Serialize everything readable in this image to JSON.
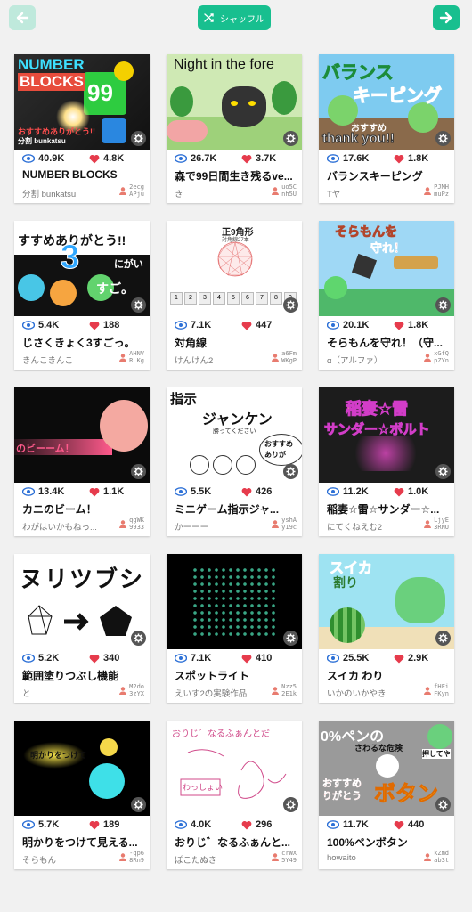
{
  "header": {
    "shuffle_label": "シャッフル"
  },
  "colors": {
    "accent": "#18bf8f",
    "accent_disabled": "#bfe9dc",
    "heart": "#e63b4c",
    "eye": "#2b6fd6"
  },
  "games": [
    {
      "views": "40.9K",
      "likes": "4.8K",
      "title": "NUMBER BLOCKS",
      "author": "分割 bunkatsu",
      "uid": "2ecg\nAPju",
      "thumb_texts": [
        "NUMBER",
        "BLOCKS",
        "99",
        "おすすめありがとう!!",
        "分割 bunkatsu"
      ]
    },
    {
      "views": "26.7K",
      "likes": "3.7K",
      "title": "森で99日間生き残るve...",
      "author": "き",
      "uid": "uo5C\nnh5U",
      "thumb_texts": [
        "Night in the fore"
      ]
    },
    {
      "views": "17.6K",
      "likes": "1.8K",
      "title": "バランスキーピング",
      "author": "Tヤ",
      "uid": "PJMH\nmuPz",
      "thumb_texts": [
        "バランス",
        "キーピング",
        "おすすめ",
        "thank you!!"
      ]
    },
    {
      "views": "5.4K",
      "likes": "188",
      "title": "じさくきょく3すごっ。",
      "author": "きんこきんこ",
      "uid": "AHNV\nRLKg",
      "thumb_texts": [
        "すすめありがとう!!",
        "3",
        "すご。",
        "にがい"
      ]
    },
    {
      "views": "7.1K",
      "likes": "447",
      "title": "対角線",
      "author": "けんけん2",
      "uid": "a6Fm\nWKgP",
      "thumb_texts": [
        "正9角形",
        "対角線27本",
        "1",
        "2",
        "3",
        "4",
        "5",
        "6",
        "7",
        "8",
        "9"
      ]
    },
    {
      "views": "20.1K",
      "likes": "1.8K",
      "title": "そらもんを守れ！（守...",
      "author": "α（アルファ）",
      "uid": "xGfQ\npZYn",
      "thumb_texts": [
        "そらもんを",
        "守れ！"
      ]
    },
    {
      "views": "13.4K",
      "likes": "1.1K",
      "title": "カニのビーム！",
      "author": "わがはいかもねっ...",
      "uid": "qgWK\n9933",
      "thumb_texts": [
        "のビーーム！"
      ]
    },
    {
      "views": "5.5K",
      "likes": "426",
      "title": "ミニゲーム指示ジャ...",
      "author": "かーーー",
      "uid": "yshA\ny19c",
      "thumb_texts": [
        "指示",
        "ジャンケン",
        "勝ってください",
        "おすすめ",
        "ありが"
      ]
    },
    {
      "views": "11.2K",
      "likes": "1.0K",
      "title": "稲妻☆雷☆サンダー☆...",
      "author": "にてくねえむ2",
      "uid": "LjyE\n3RNU",
      "thumb_texts": [
        "稲妻☆雷",
        "サンダー☆ボルト"
      ]
    },
    {
      "views": "5.2K",
      "likes": "340",
      "title": "範囲塗りつぶし機能",
      "author": "と",
      "uid": "M2do\n3zYX",
      "thumb_texts": [
        "ヌリツブシ"
      ]
    },
    {
      "views": "7.1K",
      "likes": "410",
      "title": "スポットライト",
      "author": "えいす2の実験作品",
      "uid": "Nzz5\n2E1k",
      "thumb_texts": []
    },
    {
      "views": "25.5K",
      "likes": "2.9K",
      "title": "スイカ わり",
      "author": "いかのいかやき",
      "uid": "fHFi\nFKyn",
      "thumb_texts": [
        "スイカ",
        "割り"
      ]
    },
    {
      "views": "5.7K",
      "likes": "189",
      "title": "明かりをつけて見える...",
      "author": "そらもん",
      "uid": "-qp6\n8Rn9",
      "thumb_texts": [
        "明かりをつけて"
      ]
    },
    {
      "views": "4.0K",
      "likes": "296",
      "title": "おりじ゛なるふぁんと...",
      "author": "ぽこたぬき",
      "uid": "crWX\n5Y49",
      "thumb_texts": [
        "おりじ゛なるふぁんとだ",
        "わっしょい"
      ]
    },
    {
      "views": "11.7K",
      "likes": "440",
      "title": "100%ペンボタン",
      "author": "howaito",
      "uid": "kZmd\nab3t",
      "thumb_texts": [
        "0%ペンの",
        "さわるな危険",
        "押してや",
        "おすすめ",
        "りがとう",
        "ボタン"
      ]
    }
  ]
}
